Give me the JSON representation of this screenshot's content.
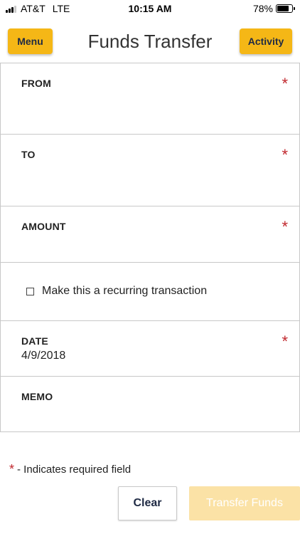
{
  "status_bar": {
    "carrier": "AT&T",
    "network": "LTE",
    "time": "10:15 AM",
    "battery_percent": "78%",
    "battery_level": 0.78,
    "signal_bars": 3,
    "signal_max": 4
  },
  "header": {
    "menu_label": "Menu",
    "title": "Funds Transfer",
    "activity_label": "Activity"
  },
  "form": {
    "from": {
      "label": "FROM",
      "required": "*"
    },
    "to": {
      "label": "TO",
      "required": "*"
    },
    "amount": {
      "label": "AMOUNT",
      "required": "*"
    },
    "recurring": {
      "label": "Make this a recurring transaction",
      "checked": false
    },
    "date": {
      "label": "DATE",
      "required": "*",
      "value": "4/9/2018"
    },
    "memo": {
      "label": "MEMO"
    }
  },
  "footer": {
    "required_star": "*",
    "required_note": "- Indicates required field",
    "clear_label": "Clear",
    "transfer_label": "Transfer Funds",
    "transfer_enabled": false
  },
  "colors": {
    "accent": "#f5b716",
    "required": "#c1272d",
    "transfer_disabled": "#fbe2a6",
    "button_text": "#1f2a44"
  },
  "icons": [
    "signal-icon",
    "battery-icon",
    "checkbox-icon"
  ]
}
